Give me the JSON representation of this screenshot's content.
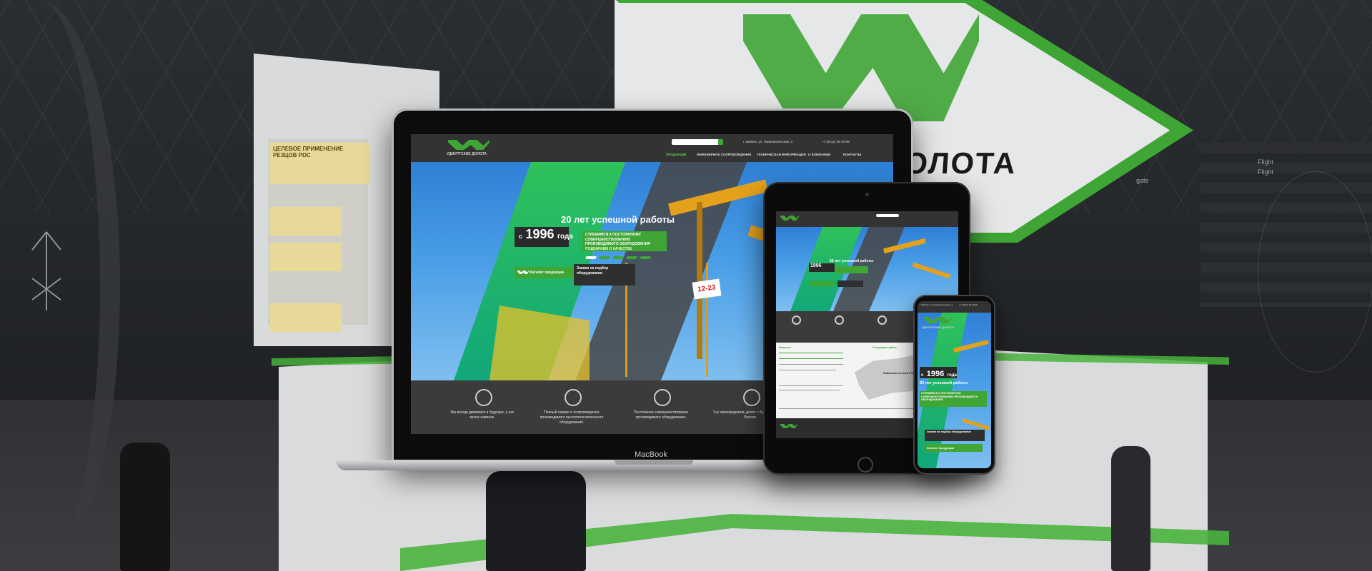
{
  "booth": {
    "logo_text": "КИЕ ДОЛОТА",
    "poster_heading": "ЦЕЛЕВОЕ ПРИМЕНЕНИЕ РЕЗЦОВ PDC",
    "departures": [
      "Flight",
      "Flight",
      "gate"
    ]
  },
  "laptop": {
    "brand": "MacBook"
  },
  "site": {
    "logo_sub": "УДМУРТСКИЕ ДОЛОТА",
    "address": "г. Ижевск, ул. Новосмоленская, 3",
    "phone": "+7 (3412) 46-10-59",
    "nav": [
      {
        "label": "ПРОДУКЦИЯ",
        "active": true
      },
      {
        "label": "ИНЖЕНЕРНОЕ СОПРОВОЖДЕНИЕ",
        "active": false
      },
      {
        "label": "ТЕХНИЧЕСКАЯ ИНФОРМАЦИЯ",
        "active": false
      },
      {
        "label": "О КОМПАНИИ",
        "active": false
      },
      {
        "label": "КОНТАКТЫ",
        "active": false
      }
    ],
    "hero": {
      "since_prefix": "с",
      "since_year": "1996",
      "since_suffix": "года",
      "tagline": "20 лет успешной работы",
      "green_text": "СТРЕМИМСЯ К ПОСТОЯННОМУ СОВЕРШЕНСТВОВАНИЮ ПРОИЗВОДИМОГО ОБОРУДОВАНИЯ",
      "green_text_tail": "ПОДБИРАЕМ О КАЧЕСТВЕ",
      "btn_catalog": "Каталог продукции",
      "btn_request": "Заявка на подбор оборудования",
      "rig_number": "12-23"
    },
    "features": [
      "Мы всегда движемся в будущее, у нас много новинок.",
      "Полный сервис и сопровождение производимого высокотехнологичного оборудования.",
      "Постоянное совершенствование производимого оборудования.",
      "Тыс производитель долот с будущими PDC в России."
    ],
    "tablet_map_label": "Работаем по всей России",
    "tablet_news_title": "Новости",
    "tablet_geo_title": "География работ"
  },
  "colors": {
    "brand_green": "#3fa535",
    "header_dark": "#333333",
    "feature_dark": "#3b3b3b"
  }
}
